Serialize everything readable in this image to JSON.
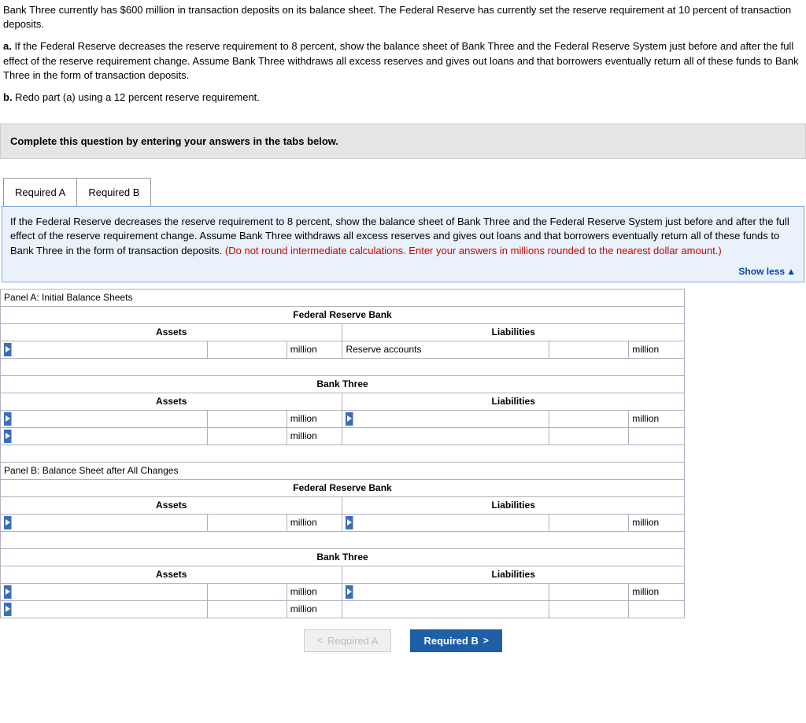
{
  "question": {
    "intro": "Bank Three currently has $600 million in transaction deposits on its balance sheet. The Federal Reserve has currently set the reserve requirement at 10 percent of transaction deposits.",
    "part_a_label": "a.",
    "part_a": " If the Federal Reserve decreases the reserve requirement to 8 percent, show the balance sheet of Bank Three and the Federal Reserve System just before and after the full effect of the reserve requirement change. Assume Bank Three withdraws all excess reserves and gives out loans and that borrowers eventually return all of these funds to Bank Three in the form of transaction deposits.",
    "part_b_label": "b.",
    "part_b": " Redo part (a) using a 12 percent reserve requirement."
  },
  "instruction": "Complete this question by entering your answers in the tabs below.",
  "tabs": {
    "a": "Required A",
    "b": "Required B"
  },
  "prompt": {
    "text": "If the Federal Reserve decreases the reserve requirement to 8 percent, show the balance sheet of Bank Three and the Federal Reserve System just before and after the full effect of the reserve requirement change. Assume Bank Three withdraws all excess reserves and gives out loans and that borrowers eventually return all of these funds to Bank Three in the form of transaction deposits. ",
    "red": "(Do not round intermediate calculations. Enter your answers in millions rounded to the nearest dollar amount.)"
  },
  "show_less": "Show less",
  "labels": {
    "panel_a": "Panel A: Initial Balance Sheets",
    "panel_b": "Panel B: Balance Sheet after All Changes",
    "frb": "Federal Reserve Bank",
    "bank3": "Bank Three",
    "assets": "Assets",
    "liabilities": "Liabilities",
    "million": "million",
    "reserve_accounts": "Reserve accounts"
  },
  "nav": {
    "prev": "Required A",
    "next": "Required B"
  }
}
